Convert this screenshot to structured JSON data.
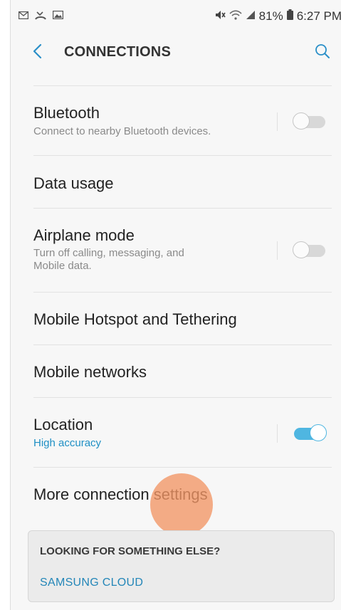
{
  "status_bar": {
    "left_icons": [
      "mail-icon",
      "missed-call-icon",
      "image-icon"
    ],
    "right_icons": [
      "mute-icon",
      "wifi-icon",
      "signal-icon"
    ],
    "battery_percent": "81%",
    "time": "6:27 PM"
  },
  "header": {
    "title": "CONNECTIONS",
    "back_icon": "chevron-left-icon",
    "search_icon": "search-icon"
  },
  "settings": {
    "bluetooth": {
      "title": "Bluetooth",
      "subtitle": "Connect to nearby Bluetooth devices.",
      "enabled": false
    },
    "data_usage": {
      "title": "Data usage"
    },
    "airplane_mode": {
      "title": "Airplane mode",
      "subtitle_line1": "Turn off calling, messaging, and",
      "subtitle_line2": "Mobile data.",
      "enabled": false
    },
    "hotspot": {
      "title": "Mobile Hotspot and Tethering"
    },
    "mobile_networks": {
      "title": "Mobile networks"
    },
    "location": {
      "title": "Location",
      "subtitle": "High accuracy",
      "enabled": true
    },
    "more_settings": {
      "title": "More connection settings"
    }
  },
  "suggestion": {
    "title": "LOOKING FOR SOMETHING ELSE?",
    "link": "SAMSUNG CLOUD"
  },
  "colors": {
    "accent": "#4fb6e1",
    "link": "#2386b8",
    "touch_indicator": "#f29665"
  }
}
